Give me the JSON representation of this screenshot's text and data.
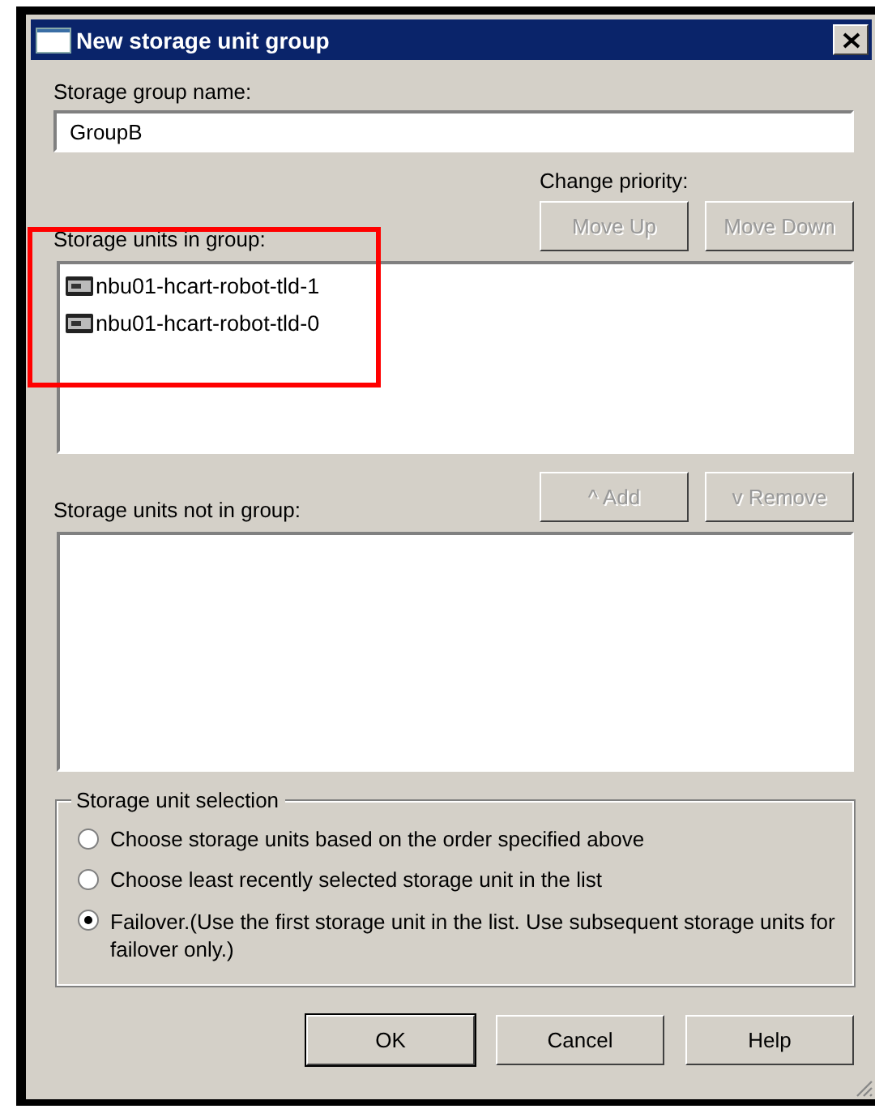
{
  "window": {
    "title": "New storage unit group"
  },
  "name_field": {
    "label": "Storage group name:",
    "value": "GroupB"
  },
  "priority": {
    "label": "Change priority:",
    "buttons": [
      {
        "label": "Move Up",
        "disabled": true
      },
      {
        "label": "Move Down",
        "disabled": true
      }
    ]
  },
  "in_group": {
    "label": "Storage units in group:",
    "highlighted": true,
    "items": [
      {
        "name": "nbu01-hcart-robot-tld-1"
      },
      {
        "name": "nbu01-hcart-robot-tld-0"
      }
    ]
  },
  "transfer_buttons": [
    {
      "label": "^ Add",
      "disabled": true
    },
    {
      "label": "v Remove",
      "disabled": true
    }
  ],
  "not_in_group": {
    "label": "Storage units not in group:"
  },
  "selection": {
    "title": "Storage unit selection",
    "options": [
      {
        "label": "Choose storage units based on the order specified above",
        "selected": false
      },
      {
        "label": "Choose least recently selected storage unit in the list",
        "selected": false
      },
      {
        "label": "Failover.(Use the first storage unit in the list. Use subsequent storage units for failover only.)",
        "selected": true
      }
    ]
  },
  "buttons": [
    {
      "label": "OK",
      "default": true
    },
    {
      "label": "Cancel",
      "default": false
    },
    {
      "label": "Help",
      "default": false
    }
  ]
}
